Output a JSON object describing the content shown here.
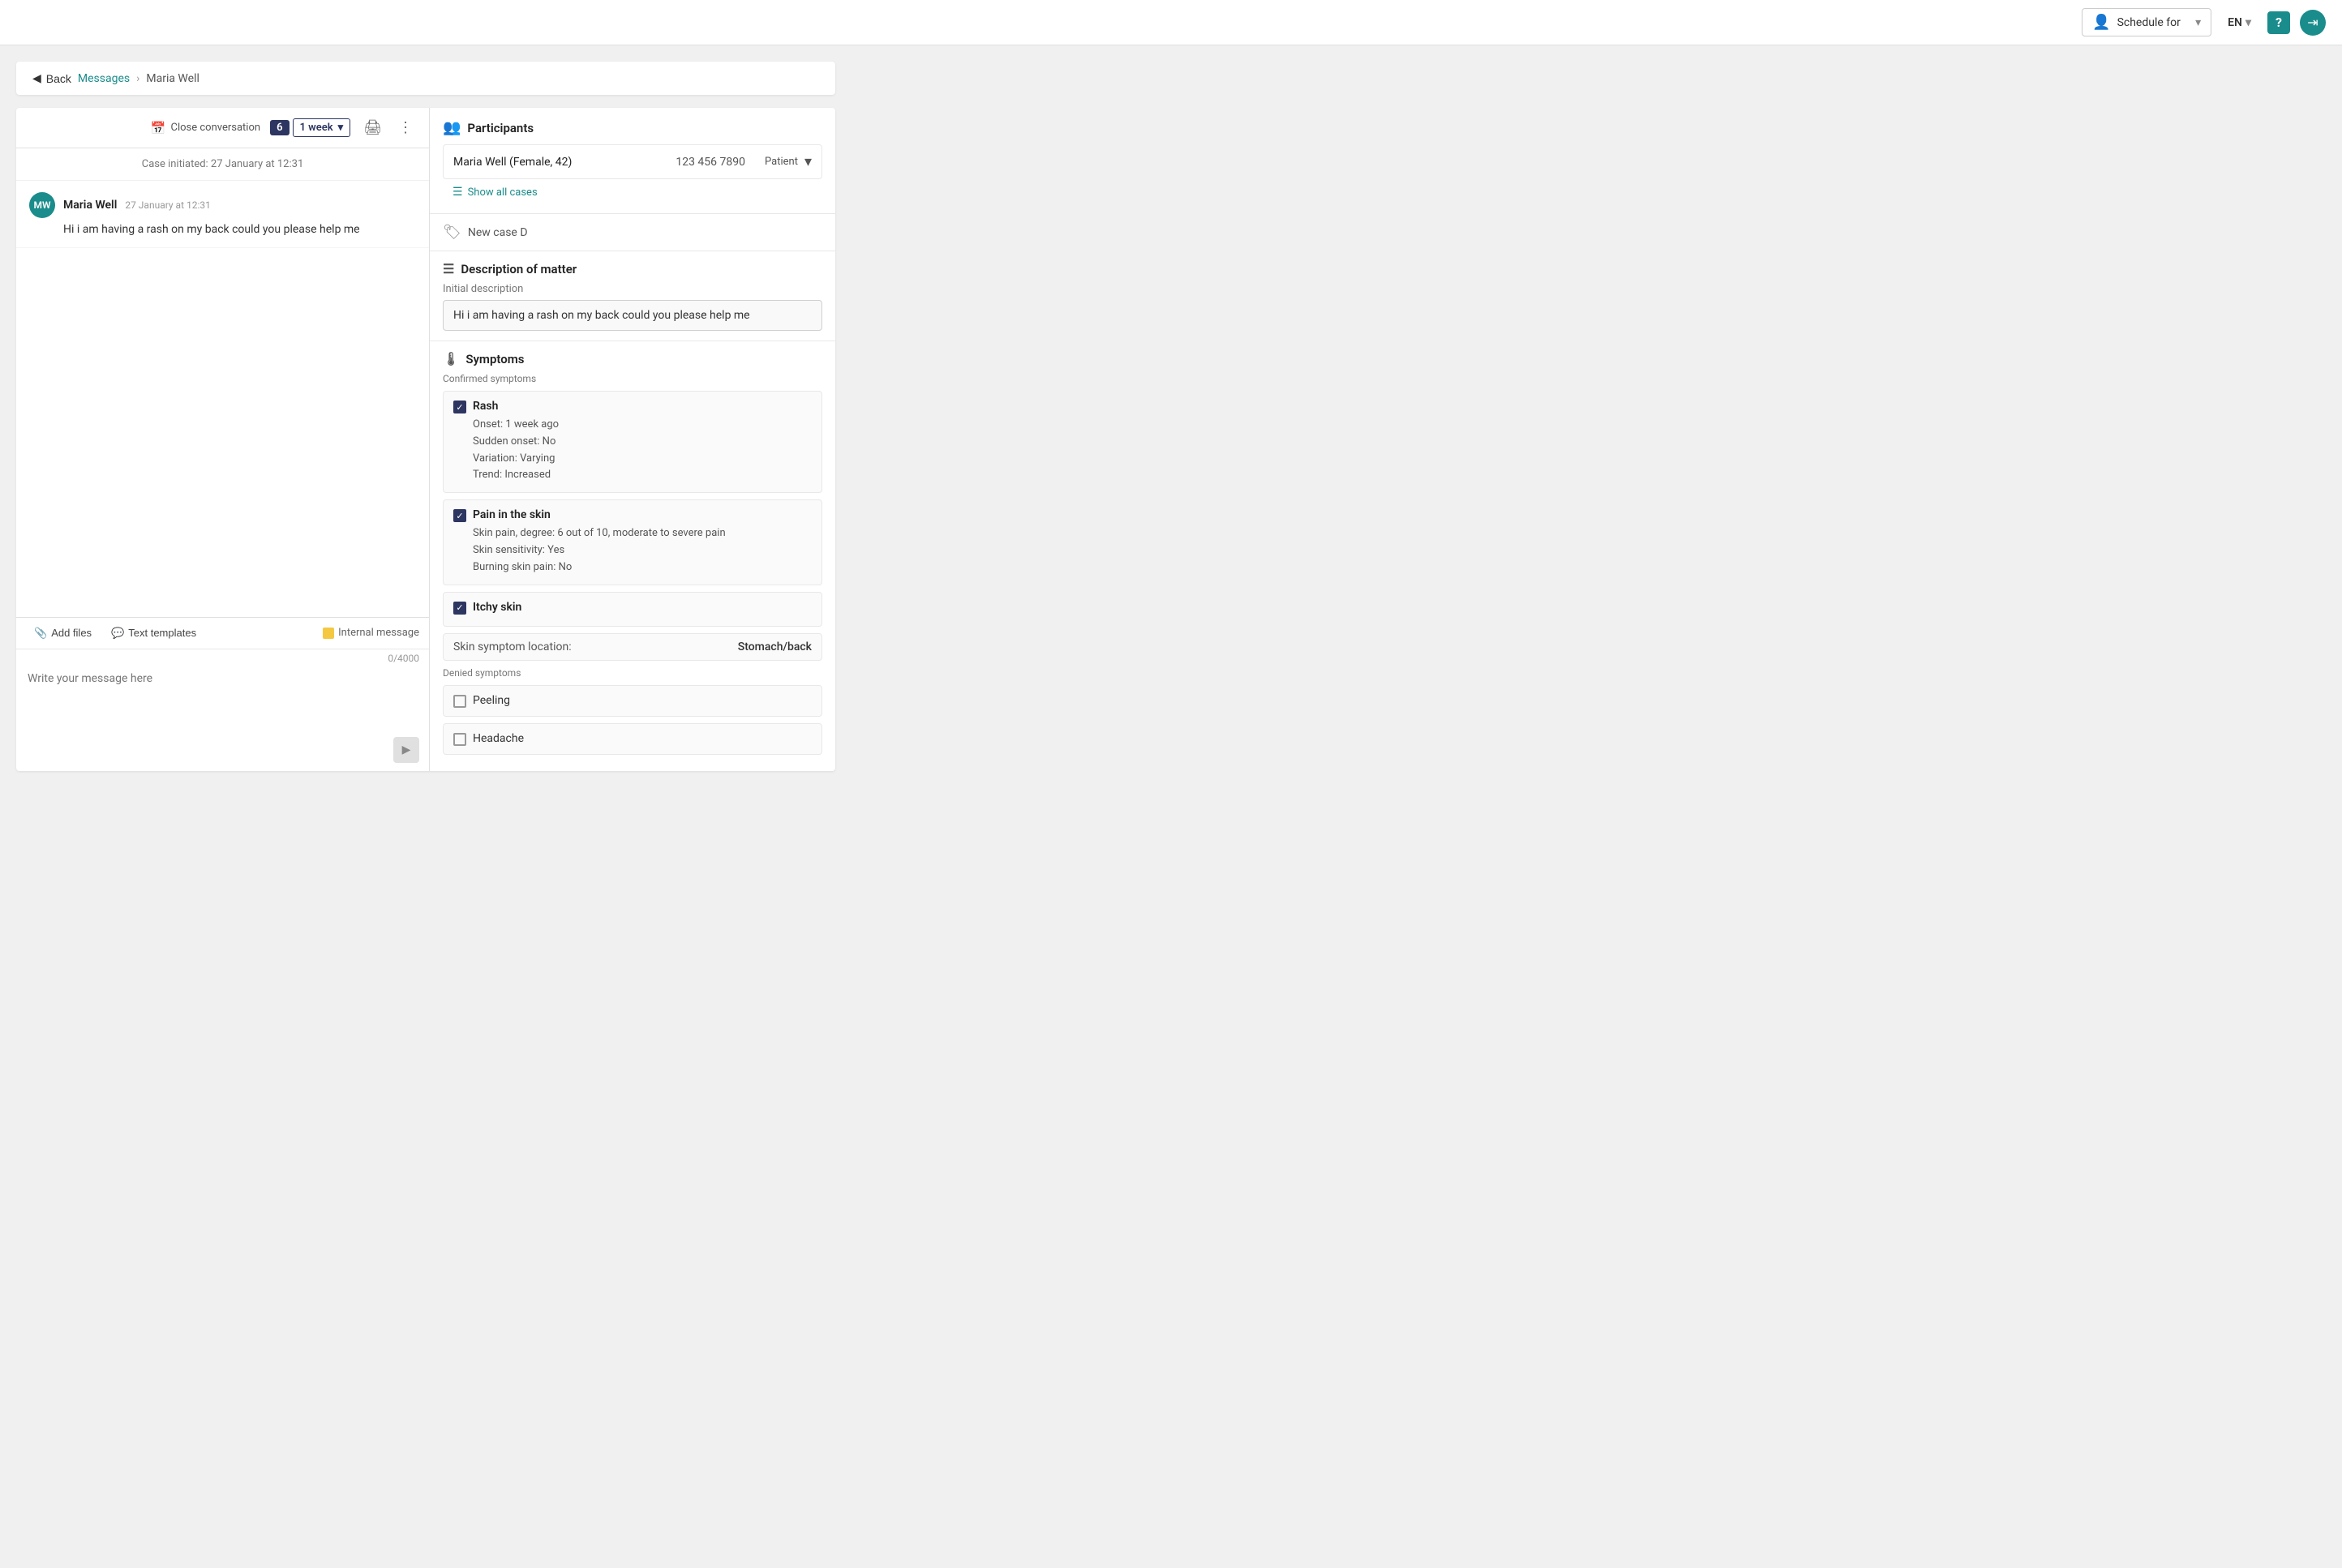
{
  "topNav": {
    "scheduleLabel": "Schedule for",
    "lang": "EN",
    "helpLabel": "?",
    "chevronDown": "▾"
  },
  "breadcrumb": {
    "backLabel": "Back",
    "messagesLabel": "Messages",
    "currentPage": "Maria Well"
  },
  "toolbar": {
    "closeConvLabel": "Close conversation",
    "badgeNum": "6",
    "weekLabel": "1 week",
    "printTitle": "Print",
    "moreTitle": "More options"
  },
  "chat": {
    "caseInitiated": "Case initiated: 27 January at 12:31",
    "sender": "Maria Well",
    "sendTime": "27 January at 12:31",
    "messageText": "Hi i am having a rash on my back could you please help me"
  },
  "inputArea": {
    "addFilesLabel": "Add files",
    "textTemplatesLabel": "Text templates",
    "internalMessageLabel": "Internal message",
    "charCount": "0/4000",
    "placeholder": "Write your message here"
  },
  "rightPanel": {
    "participantsTitle": "Participants",
    "participant": {
      "name": "Maria Well (Female, 42)",
      "phone": "123 456 7890",
      "role": "Patient"
    },
    "showAllCases": "Show all cases",
    "caseLabel": "New case D",
    "descriptionTitle": "Description of matter",
    "initialDescLabel": "Initial description",
    "initialDescText": "Hi i am having a rash on my back could you please help me",
    "symptomsTitle": "Symptoms",
    "confirmedLabel": "Confirmed symptoms",
    "symptoms": [
      {
        "name": "Rash",
        "checked": true,
        "details": [
          "Onset: 1 week ago",
          "Sudden onset: No",
          "Variation: Varying",
          "Trend: Increased"
        ]
      },
      {
        "name": "Pain in the skin",
        "checked": true,
        "details": [
          "Skin pain, degree: 6 out of 10, moderate to severe pain",
          "Skin sensitivity: Yes",
          "Burning skin pain: No"
        ]
      },
      {
        "name": "Itchy skin",
        "checked": true,
        "details": []
      }
    ],
    "skinLocationLabel": "Skin symptom location:",
    "skinLocationValue": "Stomach/back",
    "deniedLabel": "Denied symptoms",
    "deniedSymptoms": [
      {
        "name": "Peeling",
        "checked": false
      },
      {
        "name": "Headache",
        "checked": false
      }
    ]
  }
}
